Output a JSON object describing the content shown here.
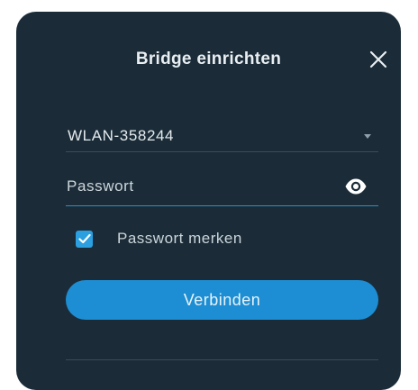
{
  "dialog": {
    "title": "Bridge einrichten",
    "close_icon": "close-icon"
  },
  "form": {
    "ssid": {
      "value": "WLAN-358244",
      "icon": "chevron-down-icon"
    },
    "password": {
      "value": "",
      "placeholder": "Passwort",
      "icon": "eye-icon"
    },
    "remember": {
      "label": "Passwort merken",
      "checked": true,
      "icon": "checkmark-icon"
    },
    "connect_label": "Verbinden"
  },
  "colors": {
    "background": "#1b2c38",
    "accent": "#1d8ed3",
    "text": "#e4eaee"
  }
}
